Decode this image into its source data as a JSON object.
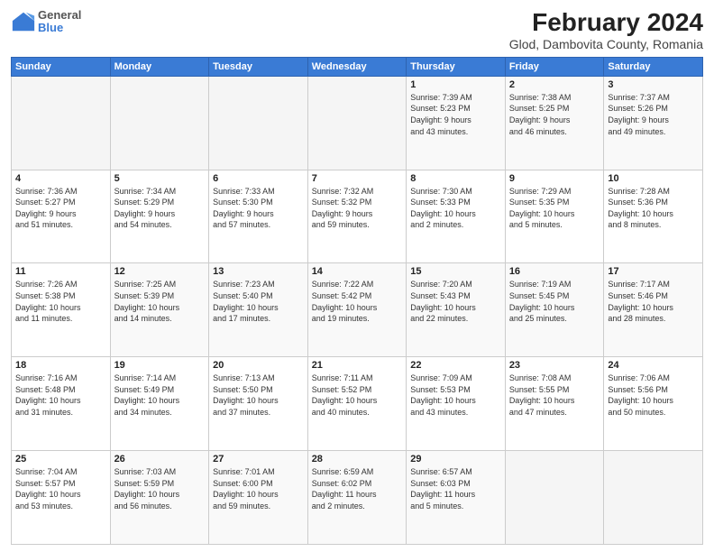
{
  "logo": {
    "general": "General",
    "blue": "Blue"
  },
  "title": "February 2024",
  "subtitle": "Glod, Dambovita County, Romania",
  "days_of_week": [
    "Sunday",
    "Monday",
    "Tuesday",
    "Wednesday",
    "Thursday",
    "Friday",
    "Saturday"
  ],
  "weeks": [
    [
      {
        "day": "",
        "info": ""
      },
      {
        "day": "",
        "info": ""
      },
      {
        "day": "",
        "info": ""
      },
      {
        "day": "",
        "info": ""
      },
      {
        "day": "1",
        "info": "Sunrise: 7:39 AM\nSunset: 5:23 PM\nDaylight: 9 hours\nand 43 minutes."
      },
      {
        "day": "2",
        "info": "Sunrise: 7:38 AM\nSunset: 5:25 PM\nDaylight: 9 hours\nand 46 minutes."
      },
      {
        "day": "3",
        "info": "Sunrise: 7:37 AM\nSunset: 5:26 PM\nDaylight: 9 hours\nand 49 minutes."
      }
    ],
    [
      {
        "day": "4",
        "info": "Sunrise: 7:36 AM\nSunset: 5:27 PM\nDaylight: 9 hours\nand 51 minutes."
      },
      {
        "day": "5",
        "info": "Sunrise: 7:34 AM\nSunset: 5:29 PM\nDaylight: 9 hours\nand 54 minutes."
      },
      {
        "day": "6",
        "info": "Sunrise: 7:33 AM\nSunset: 5:30 PM\nDaylight: 9 hours\nand 57 minutes."
      },
      {
        "day": "7",
        "info": "Sunrise: 7:32 AM\nSunset: 5:32 PM\nDaylight: 9 hours\nand 59 minutes."
      },
      {
        "day": "8",
        "info": "Sunrise: 7:30 AM\nSunset: 5:33 PM\nDaylight: 10 hours\nand 2 minutes."
      },
      {
        "day": "9",
        "info": "Sunrise: 7:29 AM\nSunset: 5:35 PM\nDaylight: 10 hours\nand 5 minutes."
      },
      {
        "day": "10",
        "info": "Sunrise: 7:28 AM\nSunset: 5:36 PM\nDaylight: 10 hours\nand 8 minutes."
      }
    ],
    [
      {
        "day": "11",
        "info": "Sunrise: 7:26 AM\nSunset: 5:38 PM\nDaylight: 10 hours\nand 11 minutes."
      },
      {
        "day": "12",
        "info": "Sunrise: 7:25 AM\nSunset: 5:39 PM\nDaylight: 10 hours\nand 14 minutes."
      },
      {
        "day": "13",
        "info": "Sunrise: 7:23 AM\nSunset: 5:40 PM\nDaylight: 10 hours\nand 17 minutes."
      },
      {
        "day": "14",
        "info": "Sunrise: 7:22 AM\nSunset: 5:42 PM\nDaylight: 10 hours\nand 19 minutes."
      },
      {
        "day": "15",
        "info": "Sunrise: 7:20 AM\nSunset: 5:43 PM\nDaylight: 10 hours\nand 22 minutes."
      },
      {
        "day": "16",
        "info": "Sunrise: 7:19 AM\nSunset: 5:45 PM\nDaylight: 10 hours\nand 25 minutes."
      },
      {
        "day": "17",
        "info": "Sunrise: 7:17 AM\nSunset: 5:46 PM\nDaylight: 10 hours\nand 28 minutes."
      }
    ],
    [
      {
        "day": "18",
        "info": "Sunrise: 7:16 AM\nSunset: 5:48 PM\nDaylight: 10 hours\nand 31 minutes."
      },
      {
        "day": "19",
        "info": "Sunrise: 7:14 AM\nSunset: 5:49 PM\nDaylight: 10 hours\nand 34 minutes."
      },
      {
        "day": "20",
        "info": "Sunrise: 7:13 AM\nSunset: 5:50 PM\nDaylight: 10 hours\nand 37 minutes."
      },
      {
        "day": "21",
        "info": "Sunrise: 7:11 AM\nSunset: 5:52 PM\nDaylight: 10 hours\nand 40 minutes."
      },
      {
        "day": "22",
        "info": "Sunrise: 7:09 AM\nSunset: 5:53 PM\nDaylight: 10 hours\nand 43 minutes."
      },
      {
        "day": "23",
        "info": "Sunrise: 7:08 AM\nSunset: 5:55 PM\nDaylight: 10 hours\nand 47 minutes."
      },
      {
        "day": "24",
        "info": "Sunrise: 7:06 AM\nSunset: 5:56 PM\nDaylight: 10 hours\nand 50 minutes."
      }
    ],
    [
      {
        "day": "25",
        "info": "Sunrise: 7:04 AM\nSunset: 5:57 PM\nDaylight: 10 hours\nand 53 minutes."
      },
      {
        "day": "26",
        "info": "Sunrise: 7:03 AM\nSunset: 5:59 PM\nDaylight: 10 hours\nand 56 minutes."
      },
      {
        "day": "27",
        "info": "Sunrise: 7:01 AM\nSunset: 6:00 PM\nDaylight: 10 hours\nand 59 minutes."
      },
      {
        "day": "28",
        "info": "Sunrise: 6:59 AM\nSunset: 6:02 PM\nDaylight: 11 hours\nand 2 minutes."
      },
      {
        "day": "29",
        "info": "Sunrise: 6:57 AM\nSunset: 6:03 PM\nDaylight: 11 hours\nand 5 minutes."
      },
      {
        "day": "",
        "info": ""
      },
      {
        "day": "",
        "info": ""
      }
    ]
  ]
}
